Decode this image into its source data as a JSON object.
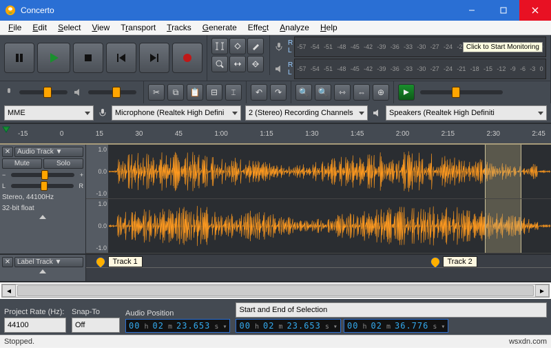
{
  "window": {
    "title": "Concerto"
  },
  "menu": [
    "File",
    "Edit",
    "Select",
    "View",
    "Transport",
    "Tracks",
    "Generate",
    "Effect",
    "Analyze",
    "Help"
  ],
  "meter": {
    "ticks": [
      "-57",
      "-54",
      "-51",
      "-48",
      "-45",
      "-42",
      "-39",
      "-36",
      "-33",
      "-30",
      "-27",
      "-24",
      "-21",
      "-18",
      "-15",
      "-12",
      "-9",
      "-6",
      "-3",
      "0"
    ],
    "hint": "Click to Start Monitoring"
  },
  "devices": {
    "host": "MME",
    "input": "Microphone (Realtek High Defini",
    "channels": "2 (Stereo) Recording Channels",
    "output": "Speakers (Realtek High Definiti"
  },
  "ruler": {
    "ticks": [
      "-15",
      "0",
      "15",
      "30",
      "45",
      "1:00",
      "1:15",
      "1:30",
      "1:45",
      "2:00",
      "2:15",
      "2:30",
      "2:45"
    ]
  },
  "audio_track": {
    "name": "Audio Track",
    "mute": "Mute",
    "solo": "Solo",
    "l": "L",
    "r": "R",
    "rate": "Stereo, 44100Hz",
    "format": "32-bit float",
    "vscale": {
      "top": "1.0",
      "mid": "0.0",
      "bot": "-1.0"
    }
  },
  "label_track": {
    "name": "Label Track",
    "labels": [
      {
        "text": "Track 1",
        "pos_pct": 2
      },
      {
        "text": "Track 2",
        "pos_pct": 74
      }
    ]
  },
  "bottom": {
    "project_rate_label": "Project Rate (Hz):",
    "project_rate": "44100",
    "snap_label": "Snap-To",
    "snap": "Off",
    "pos_label": "Audio Position",
    "sel_label": "Start and End of Selection",
    "pos_time": {
      "h": "00",
      "m": "02",
      "s": "23.653"
    },
    "sel_start": {
      "h": "00",
      "m": "02",
      "s": "23.653"
    },
    "sel_end": {
      "h": "00",
      "m": "02",
      "s": "36.776"
    }
  },
  "status": {
    "left": "Stopped.",
    "right": "wsxdn.com"
  }
}
